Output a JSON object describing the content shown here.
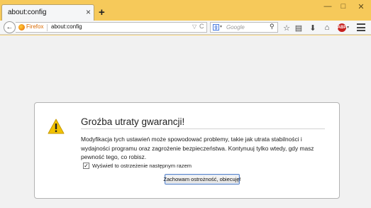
{
  "colors": {
    "titlebar": "#f6c95a",
    "toolbar": "#f5f6f7",
    "identity": "#d96a00",
    "warning": "#f2c200",
    "adblock": "#c7201e"
  },
  "tab": {
    "title": "about:config",
    "close_icon": "×"
  },
  "new_tab_label": "+",
  "window_controls": {
    "minimize": "—",
    "maximize": "□",
    "close": "✕"
  },
  "navbar": {
    "back_icon": "←",
    "identity_label": "Firefox",
    "url": "about:config",
    "url_dropdown": "▽",
    "reload_icon": "C",
    "search_engine_letter": "g",
    "search_engine_dropdown": "▾",
    "search_placeholder": "Google",
    "search_go_icon": "⚲",
    "bookmark_icon": "☆",
    "library_icon": "▤",
    "download_icon": "⬇",
    "home_icon": "⌂",
    "adblock_label": "ABP",
    "adblock_dropdown": "▾"
  },
  "warning_page": {
    "title": "Groźba utraty gwarancji!",
    "description": "Modyfikacja tych ustawień może spowodować problemy, takie jak utrata stabilności i wydajności programu oraz zagrożenie bezpieczeństwa. Kontynuuj tylko wtedy, gdy masz pewność tego, co robisz.",
    "checkbox_label": "Wyświetl to ostrzeżenie następnym razem",
    "checkbox_checked": true,
    "checkbox_mark": "✓",
    "accept_button": "Zachowam ostrożność, obiecuję!"
  }
}
